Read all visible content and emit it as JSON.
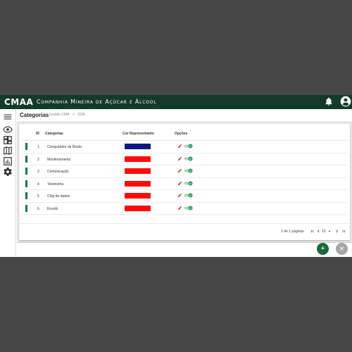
{
  "header": {
    "logo": "CMAA",
    "company": "Companhia Mineira de Açúcar e Álcool"
  },
  "page": {
    "title": "Categorias",
    "breadcrumbs": [
      "Gestão CMA",
      ">",
      "GSA"
    ]
  },
  "table": {
    "columns": {
      "id": "ID",
      "name": "Categorias",
      "color": "Cor Representante",
      "options": "Opções"
    },
    "rows": [
      {
        "id": "1",
        "name": "Computador de Bordo",
        "color": "#0a1a80"
      },
      {
        "id": "2",
        "name": "Monitoramento",
        "color": "#ff0a0a"
      },
      {
        "id": "3",
        "name": "Comunicação",
        "color": "#ff0a0a"
      },
      {
        "id": "4",
        "name": "Telemetria",
        "color": "#ff0a0a"
      },
      {
        "id": "5",
        "name": "Chip de dados",
        "color": "#ff0a0a"
      },
      {
        "id": "6",
        "name": "Envolti",
        "color": "#ff0a0a"
      }
    ]
  },
  "pagination": {
    "text": "1 de 1 páginas",
    "page_size": "10"
  },
  "colors": {
    "topbar": "#143a2a",
    "accent": "#0f7a45",
    "toggle_on": "#1f9a5a",
    "fab_add": "#1b6a3c",
    "fab_close": "#a6a6a6"
  },
  "icons": {
    "topbar": [
      "bell-icon",
      "account-circle-icon"
    ],
    "sidebar": [
      "menu-icon",
      "eye-icon",
      "dashboard-icon",
      "map-icon",
      "bar-chart-icon",
      "gear-icon"
    ],
    "row_actions": [
      "pencil-icon",
      "toggle-switch-icon"
    ],
    "pager": [
      "first-page-icon",
      "previous-page-icon",
      "dropdown-icon",
      "next-page-icon",
      "last-page-icon"
    ],
    "fabs": [
      "plus-icon",
      "close-icon"
    ]
  }
}
